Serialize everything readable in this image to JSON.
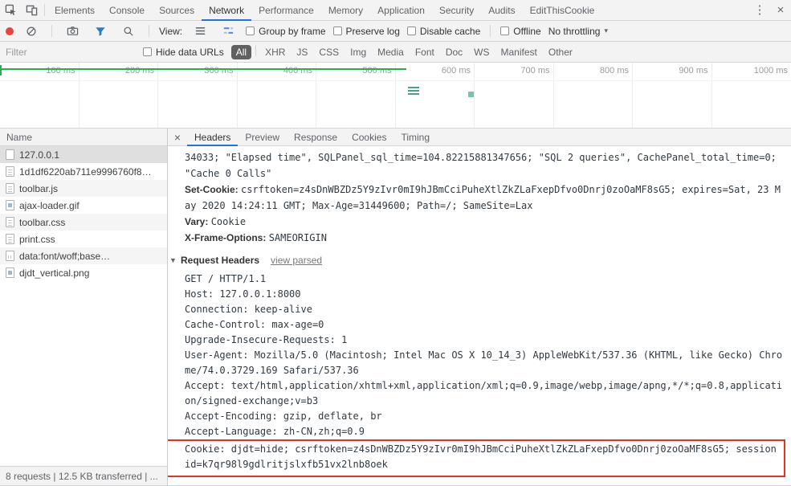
{
  "window": {
    "tabs": [
      "Elements",
      "Console",
      "Sources",
      "Network",
      "Performance",
      "Memory",
      "Application",
      "Security",
      "Audits",
      "EditThisCookie"
    ],
    "active_tab": "Network",
    "kebab_glyph": "⋮",
    "close_glyph": "×"
  },
  "network_toolbar": {
    "view_label": "View:",
    "group_by_frame": "Group by frame",
    "preserve_log": "Preserve log",
    "disable_cache": "Disable cache",
    "offline": "Offline",
    "throttling": "No throttling",
    "caret_glyph": "▾"
  },
  "filter_bar": {
    "placeholder": "Filter",
    "hide_data_urls": "Hide data URLs",
    "types": [
      "All",
      "XHR",
      "JS",
      "CSS",
      "Img",
      "Media",
      "Font",
      "Doc",
      "WS",
      "Manifest",
      "Other"
    ],
    "active_type": "All"
  },
  "timeline": {
    "ticks": [
      "100 ms",
      "200 ms",
      "300 ms",
      "400 ms",
      "500 ms",
      "600 ms",
      "700 ms",
      "800 ms",
      "900 ms",
      "1000 ms"
    ]
  },
  "requests_panel": {
    "column_header": "Name",
    "rows": [
      {
        "name": "127.0.0.1"
      },
      {
        "name": "1d1df6220ab711e9996760f8…"
      },
      {
        "name": "toolbar.js"
      },
      {
        "name": "ajax-loader.gif"
      },
      {
        "name": "toolbar.css"
      },
      {
        "name": "print.css"
      },
      {
        "name": "data:font/woff;base…"
      },
      {
        "name": "djdt_vertical.png"
      }
    ],
    "summary": "8 requests | 12.5 KB transferred | ..."
  },
  "details_panel": {
    "close_glyph": "×",
    "tabs": [
      "Headers",
      "Preview",
      "Response",
      "Cookies",
      "Timing"
    ],
    "active_tab": "Headers",
    "headers_view": {
      "continuation_value": "34033; \"Elapsed time\", SQLPanel_sql_time=104.82215881347656; \"SQL 2 queries\", CachePanel_total_time=0; \"Cache 0 Calls\"",
      "response_headers": [
        {
          "name": "Set-Cookie:",
          "value": "csrftoken=z4sDnWBZDz5Y9zIvr0mI9hJBmCciPuheXtlZkZLaFxepDfvo0Dnrj0zoOaMF8sG5; expires=Sat, 23 May 2020 14:24:11 GMT; Max-Age=31449600; Path=/; SameSite=Lax"
        },
        {
          "name": "Vary:",
          "value": "Cookie"
        },
        {
          "name": "X-Frame-Options:",
          "value": "SAMEORIGIN"
        }
      ],
      "section_arrow": "▼",
      "section_title": "Request Headers",
      "view_parsed": "view parsed",
      "request_lines": [
        "GET / HTTP/1.1",
        "Host: 127.0.0.1:8000",
        "Connection: keep-alive",
        "Cache-Control: max-age=0",
        "Upgrade-Insecure-Requests: 1",
        "User-Agent: Mozilla/5.0 (Macintosh; Intel Mac OS X 10_14_3) AppleWebKit/537.36 (KHTML, like Gecko) Chrome/74.0.3729.169 Safari/537.36",
        "Accept: text/html,application/xhtml+xml,application/xml;q=0.9,image/webp,image/apng,*/*;q=0.8,application/signed-exchange;v=b3",
        "Accept-Encoding: gzip, deflate, br",
        "Accept-Language: zh-CN,zh;q=0.9",
        "Cookie: djdt=hide; csrftoken=z4sDnWBZDz5Y9zIvr0mI9hJBmCciPuheXtlZkZLaFxepDfvo0Dnrj0zoOaMF8sG5; sessionid=k7qr98l9gdlritjslxfb51vx2lnb8oek"
      ]
    }
  },
  "colors": {
    "accent_blue": "#1a73e8",
    "record_red": "#e8453c",
    "funnel_blue": "#2f7bc0",
    "overview_green": "#26b14c",
    "highlight_red": "#e4341f"
  }
}
